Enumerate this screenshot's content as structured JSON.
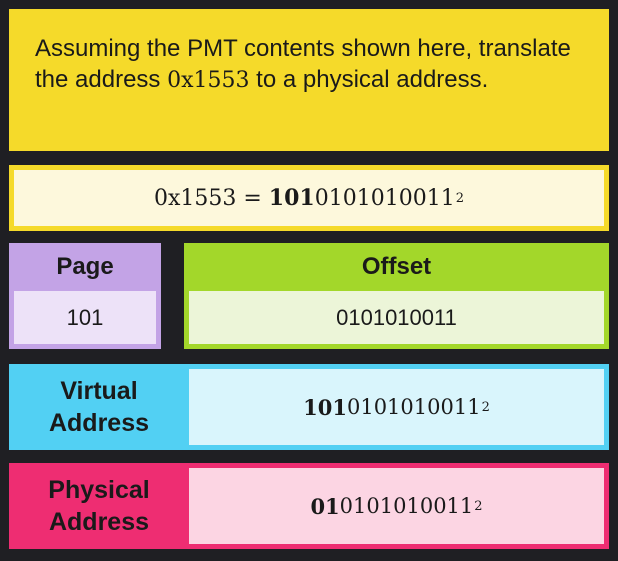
{
  "question": {
    "text_before": "Assuming the PMT contents shown here, translate the address ",
    "address": "0x1553",
    "text_after": " to a physical address."
  },
  "equation": {
    "lhs": "0x1553 = ",
    "bold_part": "101",
    "rest": "0101010011",
    "base": "2"
  },
  "table": {
    "page_header": "Page",
    "page_value": "101",
    "offset_header": "Offset",
    "offset_value": "0101010011"
  },
  "virtual": {
    "label_line1": "Virtual",
    "label_line2": "Address",
    "bold_part": "101",
    "rest": "0101010011",
    "base": "2"
  },
  "physical": {
    "label_line1": "Physical",
    "label_line2": "Address",
    "bold_part": "01",
    "rest": "0101010011",
    "base": "2"
  },
  "colors": {
    "yellow": "#f5da2a",
    "purple": "#c3a3e6",
    "green": "#a3d72a",
    "cyan": "#52d0f3",
    "pink": "#ee2d72",
    "background": "#1f1f23"
  }
}
